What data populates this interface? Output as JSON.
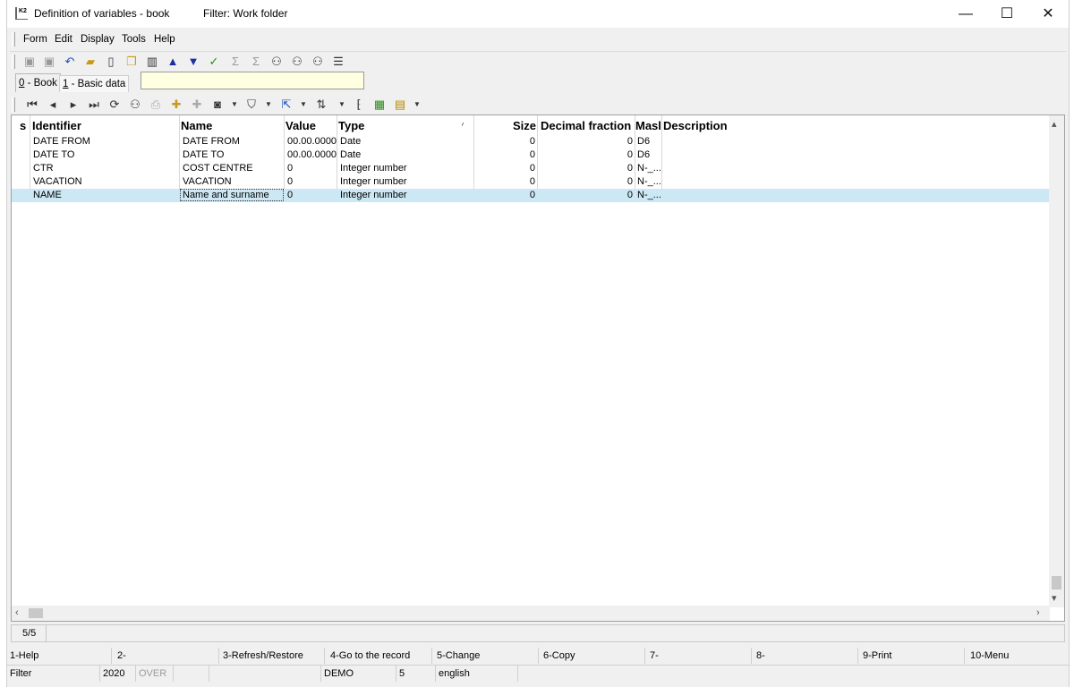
{
  "window": {
    "title": "Definition of variables - book",
    "filter": "Filter: Work folder",
    "app_icon_text": "K2",
    "minimize_label": "—",
    "maximize_label": "☐",
    "close_label": "✕"
  },
  "menu": [
    {
      "label": "Form"
    },
    {
      "label": "Edit"
    },
    {
      "label": "Display"
    },
    {
      "label": "Tools"
    },
    {
      "label": "Help"
    }
  ],
  "toolbar": {
    "icons": [
      "save-icon",
      "save-as-icon",
      "undo-icon",
      "open-folder-icon",
      "new-document-icon",
      "copy-document-icon",
      "book-icon",
      "arrow-up-icon",
      "arrow-down-icon",
      "check-icon",
      "sum-icon",
      "sum-filter-icon",
      "find-icon",
      "find-next-icon",
      "find-replace-icon",
      "menu-lines-icon"
    ]
  },
  "tabs": [
    {
      "label": "0 - Book",
      "key": "0",
      "text": " - Book"
    },
    {
      "label": "1 - Basic data",
      "key": "1",
      "text": " - Basic data"
    }
  ],
  "grid": {
    "columns": [
      {
        "label": "s"
      },
      {
        "label": "Identifier"
      },
      {
        "label": "Name"
      },
      {
        "label": "Value"
      },
      {
        "label": "Type"
      },
      {
        "label": "Size"
      },
      {
        "label": "Decimal fraction"
      },
      {
        "label": "Masl"
      },
      {
        "label": "Description"
      }
    ],
    "sort_indicator": "⁄",
    "rows": [
      {
        "identifier": "DATE FROM",
        "name": "DATE FROM",
        "value": "00.00.0000",
        "type": "Date",
        "size": "0",
        "decimal": "0",
        "mask": "D6",
        "description": ""
      },
      {
        "identifier": "DATE TO",
        "name": "DATE TO",
        "value": "00.00.0000",
        "type": "Date",
        "size": "0",
        "decimal": "0",
        "mask": "D6",
        "description": ""
      },
      {
        "identifier": "CTR",
        "name": "COST CENTRE",
        "value": "0",
        "type": "Integer number",
        "size": "0",
        "decimal": "0",
        "mask": "N-_...",
        "description": ""
      },
      {
        "identifier": "VACATION",
        "name": "VACATION",
        "value": "0",
        "type": "Integer number",
        "size": "0",
        "decimal": "0",
        "mask": "N-_...",
        "description": ""
      },
      {
        "identifier": "NAME",
        "name": "Name and surname",
        "value": "0",
        "type": "Integer number",
        "size": "0",
        "decimal": "0",
        "mask": "N-_...",
        "description": ""
      }
    ],
    "selected_row": 4
  },
  "status": {
    "record_count": "5/5"
  },
  "function_keys": [
    "1-Help",
    "2-",
    "3-Refresh/Restore",
    "4-Go to the record",
    "5-Change",
    "6-Copy",
    "7-",
    "8-",
    "9-Print",
    "10-Menu"
  ],
  "bottom_bar": {
    "mode": "Filter",
    "year": "2020",
    "insert_mode": "OVER",
    "database": "DEMO",
    "company": "5",
    "language": "english"
  }
}
